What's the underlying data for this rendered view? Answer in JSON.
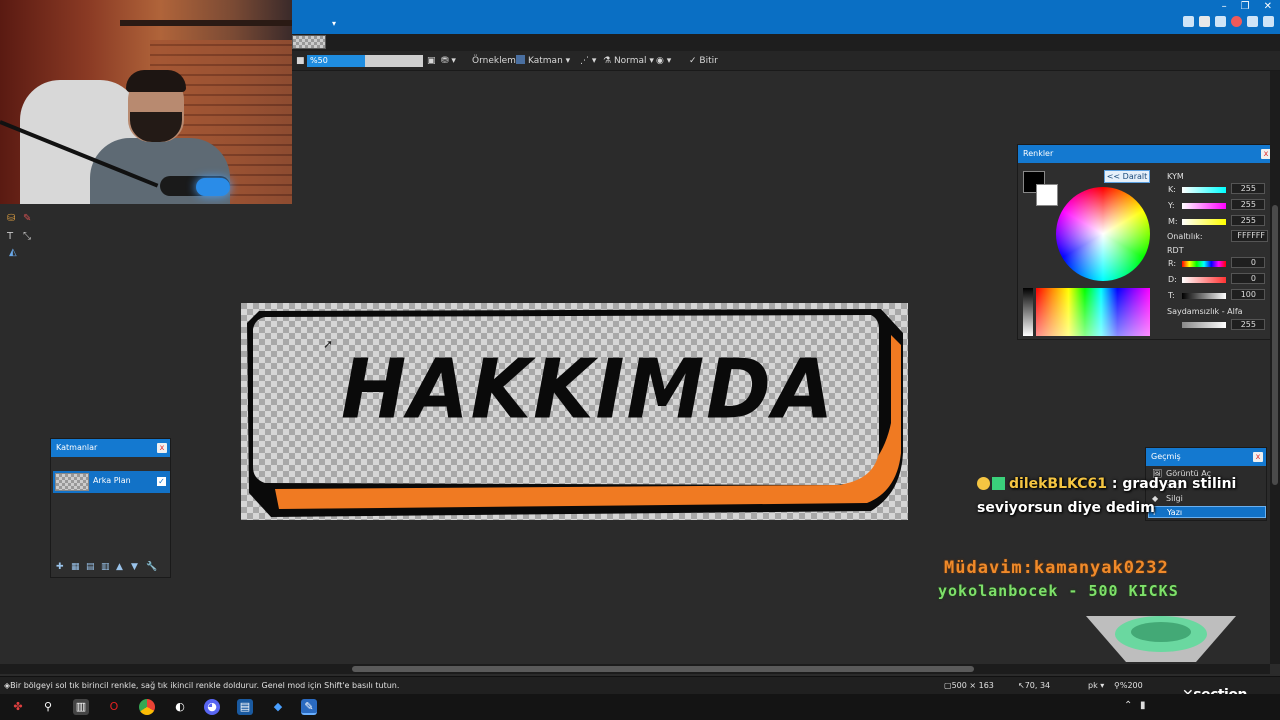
{
  "toolbar": {
    "zoom_value": "%50",
    "sampling_label": "Örnekleme:",
    "sampling_value": "Katman",
    "blend_mode": "Normal",
    "finish_label": "Bitir"
  },
  "canvas": {
    "text": "HAKKIMDA",
    "colors": {
      "outline": "#0a0a0a",
      "accent": "#f07a22"
    }
  },
  "layers_panel": {
    "title": "Katmanlar",
    "layers": [
      {
        "name": "Arka Plan",
        "visible": true
      }
    ]
  },
  "colors_panel": {
    "title": "Renkler",
    "collapse_label": "<< Daralt",
    "cmy_label": "KYM",
    "cmy": [
      {
        "label": "K:",
        "value": "255"
      },
      {
        "label": "Y:",
        "value": "255"
      },
      {
        "label": "M:",
        "value": "255"
      }
    ],
    "hex_label": "Onaltılık:",
    "hex_value": "FFFFFF",
    "hsv_label": "RDT",
    "hsv": [
      {
        "label": "R:",
        "value": "0"
      },
      {
        "label": "D:",
        "value": "0"
      },
      {
        "label": "T:",
        "value": "100"
      }
    ],
    "alpha_label": "Saydamsızlık - Alfa",
    "alpha_value": "255"
  },
  "history_panel": {
    "title": "Geçmiş",
    "items": [
      {
        "label": "Görüntü Aç",
        "icon": "image-icon"
      },
      {
        "label": "Silgi",
        "icon": "eraser-icon"
      },
      {
        "label": "Silgi",
        "icon": "eraser-icon"
      },
      {
        "label": "Yazı",
        "icon": "text-icon"
      }
    ]
  },
  "chat": {
    "username": "dilekBLKC61",
    "message_part1": ": gradyan stilini",
    "message_part2": "seviyorsun diye dedim"
  },
  "tickers": {
    "line1": "Müdavim:kamanyak0232",
    "line2": "yokolanbocek - 500 KICKS"
  },
  "statusbar": {
    "hint": "Bir bölgeyi sol tık birincil renkle, sağ tık ikincil renkle doldurur. Genel mod için Shift'e basılı tutun.",
    "image_size": "500 × 163",
    "cursor_pos": "70, 34",
    "units": "pk",
    "zoom": "%200",
    "brand": "section"
  }
}
